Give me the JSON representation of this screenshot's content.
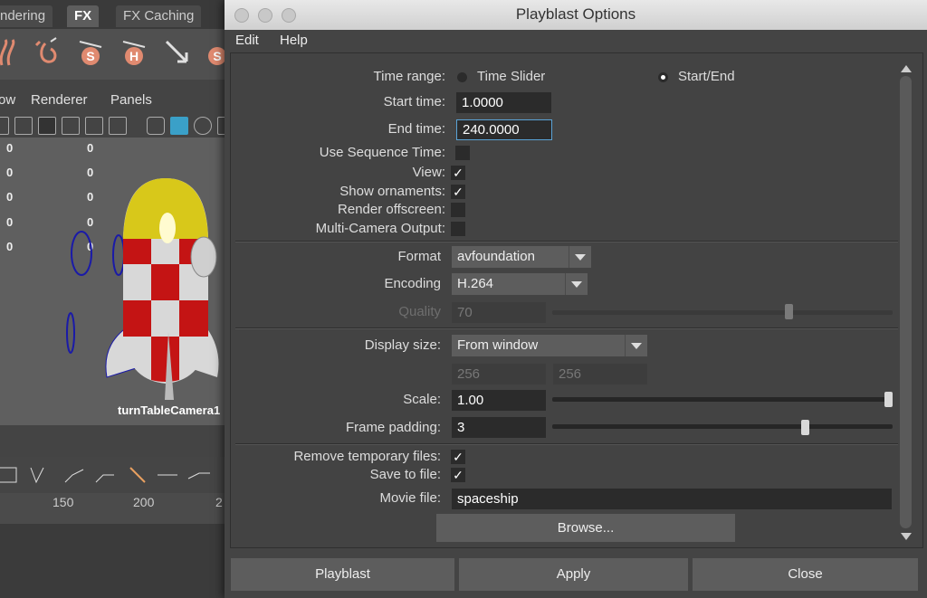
{
  "background_app": {
    "shelf_tabs": [
      "ndering",
      "FX",
      "FX Caching"
    ],
    "active_shelf_tab": "FX",
    "viewport_menus": [
      "ow",
      "Renderer",
      "Panels"
    ],
    "hud_values": [
      [
        "0",
        "0"
      ],
      [
        "0",
        "0"
      ],
      [
        "0",
        "0"
      ],
      [
        "0",
        "0"
      ],
      [
        "0",
        "0"
      ]
    ],
    "camera_label": "turnTableCamera1",
    "timeline_ticks": [
      "150",
      "200",
      "2"
    ]
  },
  "dialog": {
    "title": "Playblast Options",
    "menus": [
      "Edit",
      "Help"
    ],
    "time_range": {
      "label": "Time range:",
      "options": [
        "Time Slider",
        "Start/End"
      ],
      "selected": "Start/End"
    },
    "start_time": {
      "label": "Start time:",
      "value": "1.0000"
    },
    "end_time": {
      "label": "End time:",
      "value": "240.0000"
    },
    "use_sequence_time": {
      "label": "Use Sequence Time:",
      "checked": false
    },
    "view": {
      "label": "View:",
      "checked": true
    },
    "show_ornaments": {
      "label": "Show ornaments:",
      "checked": true
    },
    "render_offscreen": {
      "label": "Render offscreen:",
      "checked": false
    },
    "multi_camera": {
      "label": "Multi-Camera Output:",
      "checked": false
    },
    "format": {
      "label": "Format",
      "value": "avfoundation"
    },
    "encoding": {
      "label": "Encoding",
      "value": "H.264"
    },
    "quality": {
      "label": "Quality",
      "value": "70",
      "level": 0.7
    },
    "display_size": {
      "label": "Display size:",
      "value": "From window",
      "width": "256",
      "height": "256"
    },
    "scale": {
      "label": "Scale:",
      "value": "1.00",
      "level": 1.0
    },
    "frame_padding": {
      "label": "Frame padding:",
      "value": "3",
      "level": 0.75
    },
    "remove_temp": {
      "label": "Remove temporary files:",
      "checked": true
    },
    "save_to_file": {
      "label": "Save to file:",
      "checked": true
    },
    "movie_file": {
      "label": "Movie file:",
      "value": "spaceship"
    },
    "browse_label": "Browse...",
    "buttons": {
      "playblast": "Playblast",
      "apply": "Apply",
      "close": "Close"
    }
  },
  "colors": {
    "focus_border": "#5aa3d6",
    "rocket_yellow": "#d8c81a",
    "rocket_red": "#c41414"
  }
}
